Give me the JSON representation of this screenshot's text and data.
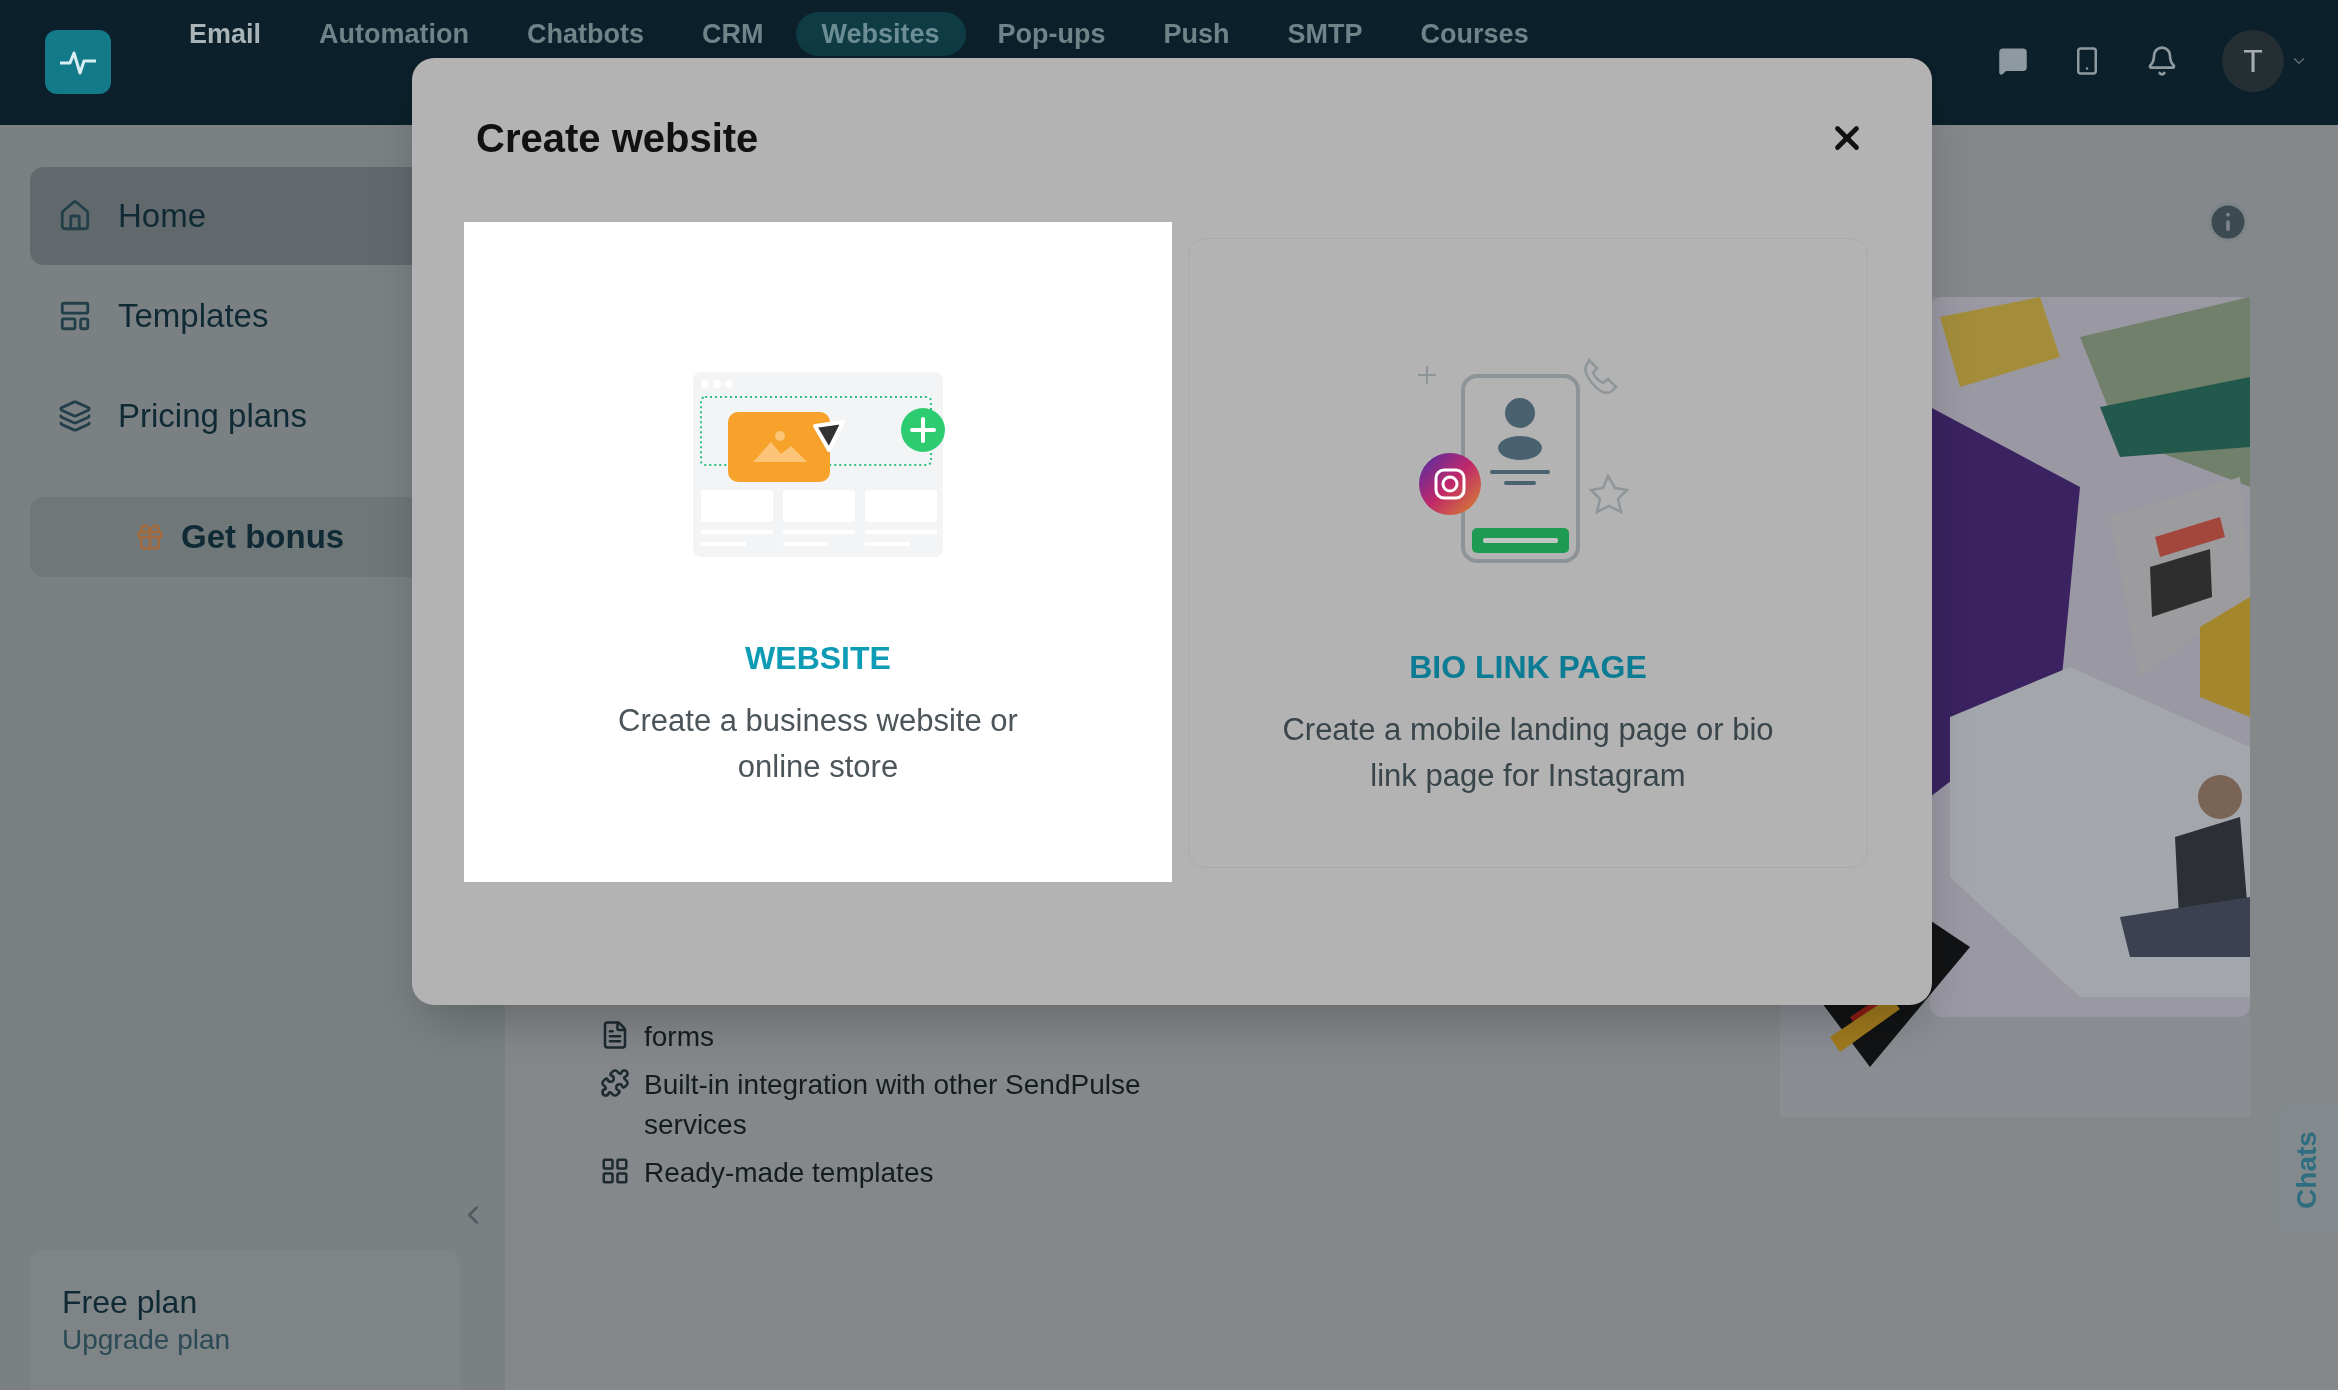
{
  "nav": {
    "items": [
      {
        "label": "Email",
        "selected": false
      },
      {
        "label": "Automation",
        "selected": false
      },
      {
        "label": "Chatbots",
        "selected": false
      },
      {
        "label": "CRM",
        "selected": false
      },
      {
        "label": "Websites",
        "selected": true
      },
      {
        "label": "Pop-ups",
        "selected": false
      },
      {
        "label": "Push",
        "selected": false
      },
      {
        "label": "SMTP",
        "selected": false
      },
      {
        "label": "Courses",
        "selected": false
      }
    ],
    "avatar": "T"
  },
  "sidebar": {
    "items": [
      {
        "kind": "home",
        "label": "Home",
        "selected": true
      },
      {
        "kind": "templates",
        "label": "Templates",
        "selected": false
      },
      {
        "kind": "pricing",
        "label": "Pricing plans",
        "selected": false
      }
    ],
    "bonus_button": "Get bonus",
    "plan": {
      "name": "Free plan",
      "link": "Upgrade plan"
    }
  },
  "main": {
    "features": [
      {
        "kind": "form",
        "text": "forms"
      },
      {
        "kind": "integration",
        "text": "Built-in integration with other SendPulse services"
      },
      {
        "kind": "templates",
        "text": "Ready-made templates"
      }
    ]
  },
  "chats_tab": "Chats",
  "modal": {
    "title": "Create website",
    "options": [
      {
        "kind": "website",
        "title": "WEBSITE",
        "description": "Create a business website or online store",
        "selected": true
      },
      {
        "kind": "bio_link",
        "title": "BIO LINK PAGE",
        "description": "Create a mobile landing page or bio link page for Instagram",
        "selected": false
      }
    ]
  }
}
